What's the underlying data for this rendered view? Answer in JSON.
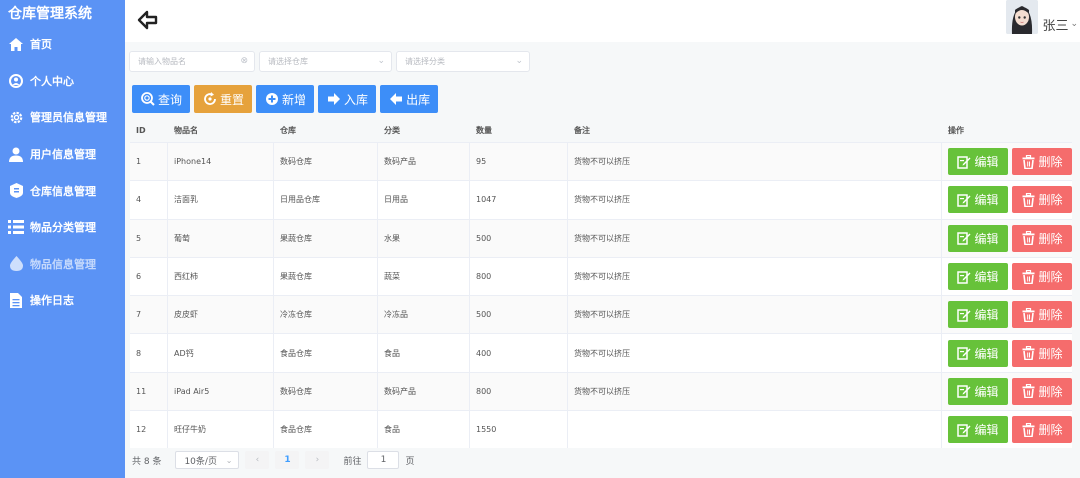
{
  "sidebar": {
    "title": "仓库管理系统",
    "items": [
      {
        "label": "首页",
        "icon": "home-icon"
      },
      {
        "label": "个人中心",
        "icon": "user-circle-icon"
      },
      {
        "label": "管理员信息管理",
        "icon": "gear-icon"
      },
      {
        "label": "用户信息管理",
        "icon": "user-icon"
      },
      {
        "label": "仓库信息管理",
        "icon": "warehouse-icon"
      },
      {
        "label": "物品分类管理",
        "icon": "list-icon"
      },
      {
        "label": "物品信息管理",
        "icon": "drop-icon"
      },
      {
        "label": "操作日志",
        "icon": "document-icon"
      }
    ]
  },
  "header": {
    "user_name": "张三"
  },
  "filters": {
    "name_placeholder": "请输入物品名",
    "warehouse_placeholder": "请选择仓库",
    "category_placeholder": "请选择分类"
  },
  "actions": {
    "search": "查询",
    "reset": "重置",
    "add": "新增",
    "stock_in": "入库",
    "stock_out": "出库"
  },
  "table": {
    "columns": {
      "id": "ID",
      "name": "物品名",
      "warehouse": "仓库",
      "category": "分类",
      "quantity": "数量",
      "note": "备注",
      "operation": "操作"
    },
    "edit_label": "编辑",
    "delete_label": "删除",
    "rows": [
      {
        "id": "1",
        "name": "iPhone14",
        "warehouse": "数码仓库",
        "category": "数码产品",
        "quantity": "95",
        "note": "货物不可以挤压"
      },
      {
        "id": "4",
        "name": "洁面乳",
        "warehouse": "日用品仓库",
        "category": "日用品",
        "quantity": "1047",
        "note": "货物不可以挤压"
      },
      {
        "id": "5",
        "name": "葡萄",
        "warehouse": "果蔬仓库",
        "category": "水果",
        "quantity": "500",
        "note": "货物不可以挤压"
      },
      {
        "id": "6",
        "name": "西红柿",
        "warehouse": "果蔬仓库",
        "category": "蔬菜",
        "quantity": "800",
        "note": "货物不可以挤压"
      },
      {
        "id": "7",
        "name": "皮皮虾",
        "warehouse": "冷冻仓库",
        "category": "冷冻品",
        "quantity": "500",
        "note": "货物不可以挤压"
      },
      {
        "id": "8",
        "name": "AD钙",
        "warehouse": "食品仓库",
        "category": "食品",
        "quantity": "400",
        "note": "货物不可以挤压"
      },
      {
        "id": "11",
        "name": "iPad Air5",
        "warehouse": "数码仓库",
        "category": "数码产品",
        "quantity": "800",
        "note": "货物不可以挤压"
      },
      {
        "id": "12",
        "name": "旺仔牛奶",
        "warehouse": "食品仓库",
        "category": "食品",
        "quantity": "1550",
        "note": ""
      }
    ]
  },
  "pager": {
    "total": "共 8 条",
    "page_size": "10条/页",
    "current_page": "1",
    "goto_label": "前往",
    "goto_value": "1",
    "page_unit": "页"
  },
  "colors": {
    "sidebar": "#5b93f5",
    "primary": "#3d8ef8",
    "warning": "#e6a23c",
    "success": "#67c23a",
    "danger": "#f56c6c"
  }
}
